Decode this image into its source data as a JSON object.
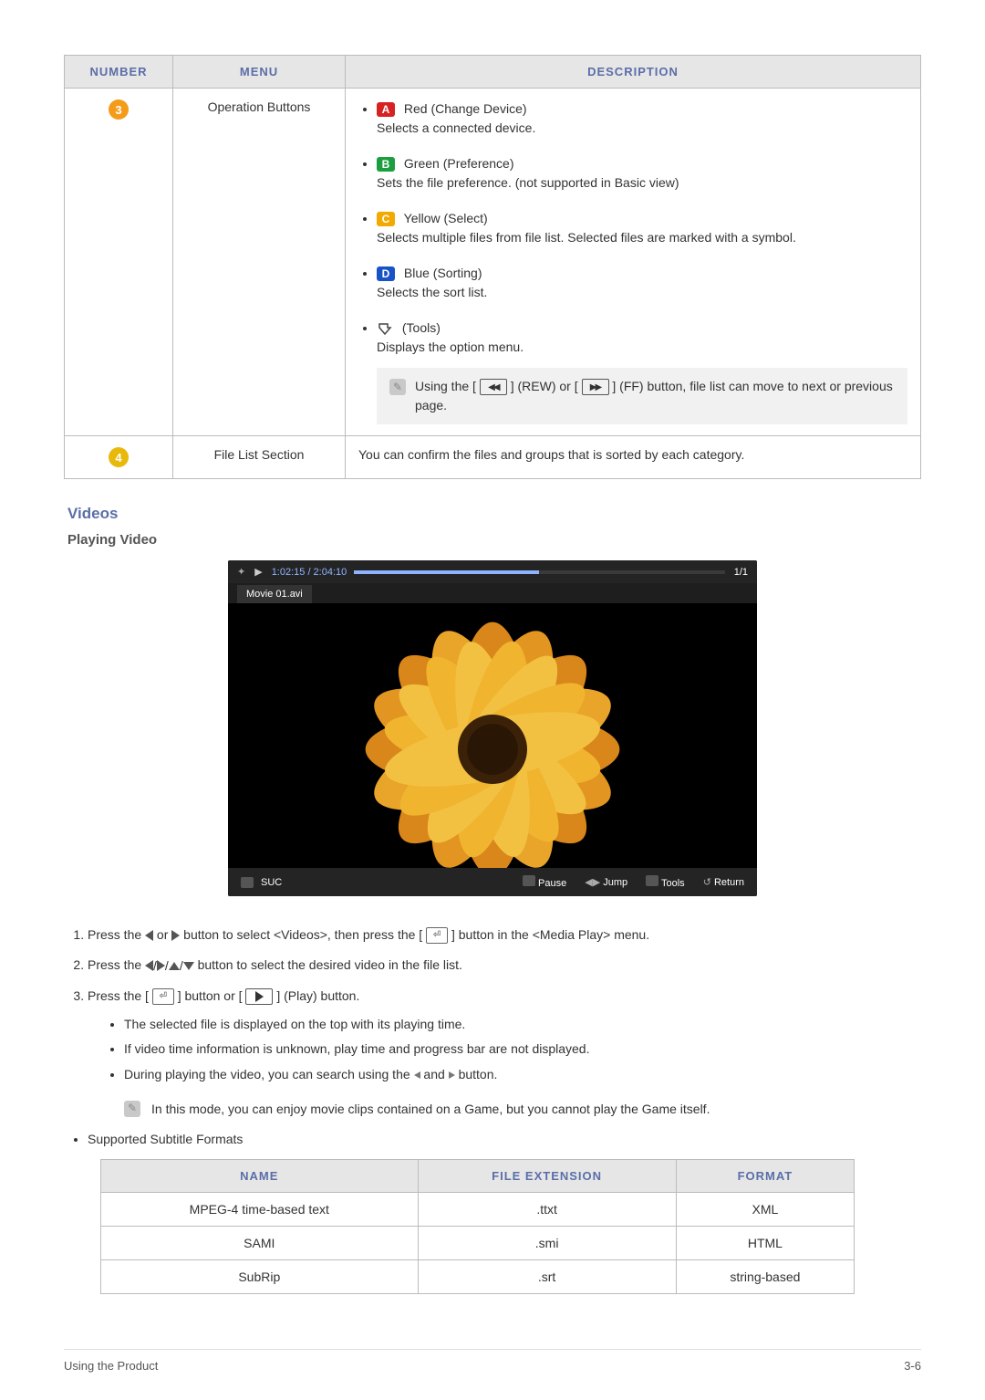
{
  "table1": {
    "headers": {
      "number": "Number",
      "menu": "Menu",
      "description": "Description"
    },
    "rows": [
      {
        "num": "3",
        "menu": "Operation Buttons",
        "desc": {
          "red_label": "Red (Change Device)",
          "red_text": "Selects a connected device.",
          "green_label": "Green (Preference)",
          "green_text": "Sets the file preference. (not supported in Basic view)",
          "yellow_label": "Yellow (Select)",
          "yellow_text": "Selects multiple files from file list. Selected files are marked with a symbol.",
          "blue_label": "Blue (Sorting)",
          "blue_text": "Selects the sort list.",
          "tools_label": "(Tools)",
          "tools_text": "Displays the option menu.",
          "notebox_a": "Using the [",
          "notebox_b": "] (REW) or [",
          "notebox_c": "] (FF) button, file list can move to next or previous page."
        }
      },
      {
        "num": "4",
        "menu": "File List Section",
        "desc_text": "You can confirm the files and groups that is sorted by each category."
      }
    ]
  },
  "videos_heading": "Videos",
  "playing_heading": "Playing Video",
  "player": {
    "time": "1:02:15 / 2:04:10",
    "index": "1/1",
    "filename": "Movie 01.avi",
    "suc": "SUC",
    "pause": "Pause",
    "jump": "Jump",
    "tools": "Tools",
    "return": "Return"
  },
  "steps": {
    "s1a": "Press the ",
    "s1b": " or ",
    "s1c": " button to select <Videos>, then press the [",
    "s1d": "] button in the <Media Play> menu.",
    "s2a": "Press the ",
    "s2b": " button to select the desired video in the file list.",
    "s3a": "Press the [",
    "s3b": "] button or [",
    "s3c": "] (Play) button.",
    "b1": "The selected file is displayed on the top with its playing time.",
    "b2": "If video time information is unknown, play time and progress bar are not displayed.",
    "b3a": "During playing the video, you can search using the ",
    "b3b": " and ",
    "b3c": " button.",
    "note": "In this mode, you can enjoy movie clips contained on a Game, but you cannot play the Game itself.",
    "bullet_sub": "Supported Subtitle Formats"
  },
  "subtable": {
    "headers": {
      "name": "Name",
      "ext": "File Extension",
      "format": "Format"
    },
    "rows": [
      {
        "name": "MPEG-4 time-based text",
        "ext": ".ttxt",
        "format": "XML"
      },
      {
        "name": "SAMI",
        "ext": ".smi",
        "format": "HTML"
      },
      {
        "name": "SubRip",
        "ext": ".srt",
        "format": "string-based"
      }
    ]
  },
  "footer": {
    "left": "Using the Product",
    "right": "3-6"
  }
}
